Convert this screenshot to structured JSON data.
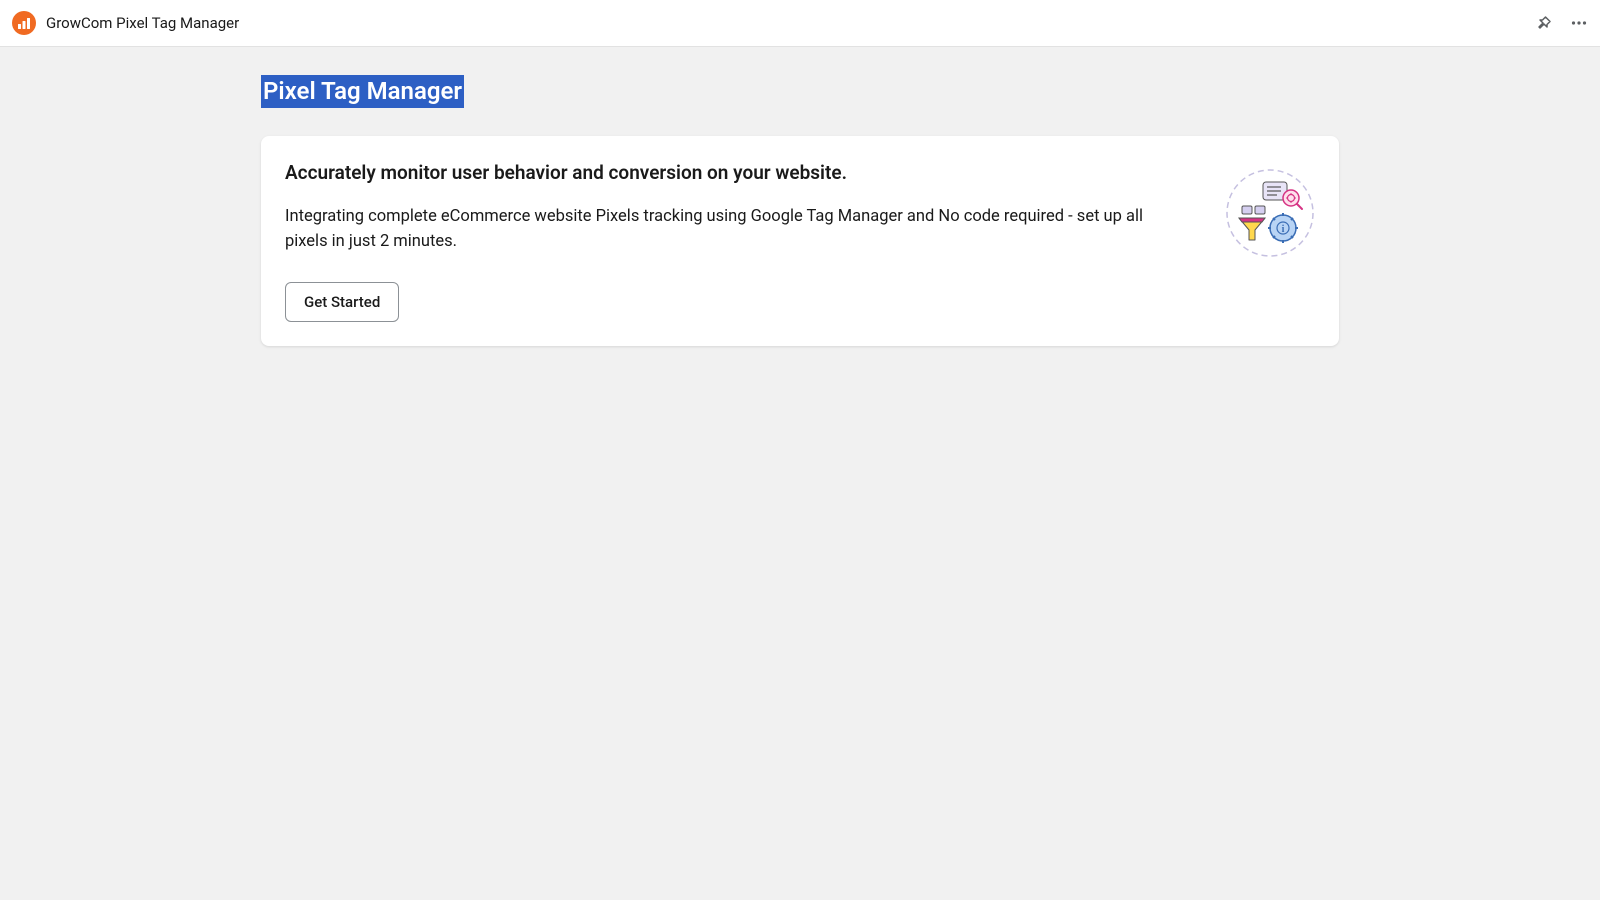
{
  "topbar": {
    "app_title": "GrowCom Pixel Tag Manager"
  },
  "page": {
    "title": "Pixel Tag Manager"
  },
  "card": {
    "heading": "Accurately monitor user behavior and conversion on your website.",
    "description": "Integrating complete eCommerce website Pixels tracking using Google Tag Manager and No code required - set up all pixels in just 2 minutes.",
    "cta_label": "Get Started"
  }
}
